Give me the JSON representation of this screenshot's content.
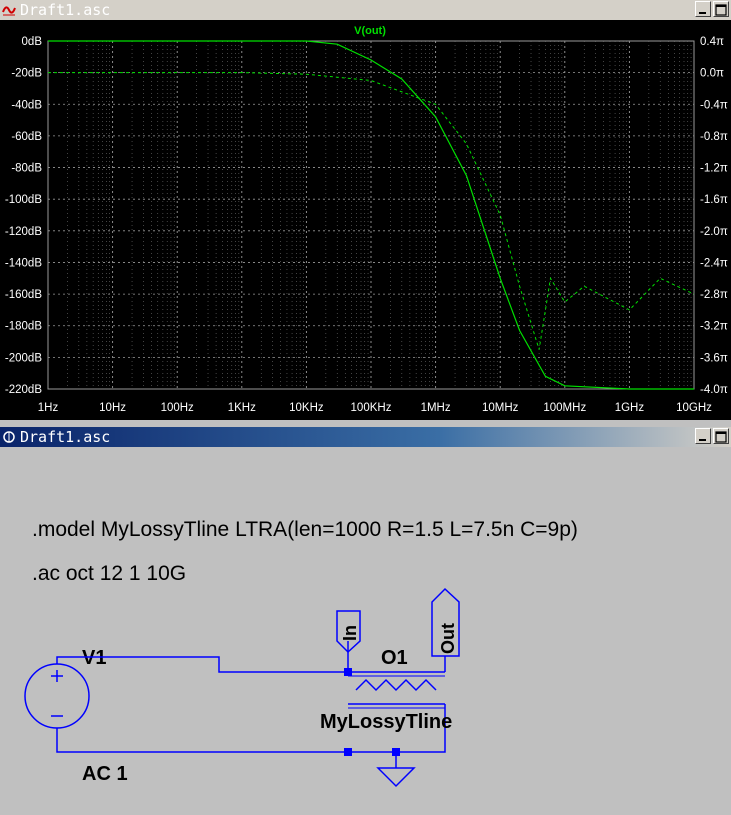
{
  "window_plot": {
    "title": "Draft1.asc"
  },
  "window_schematic": {
    "title": "Draft1.asc"
  },
  "plot": {
    "trace_label": "V(out)",
    "left_axis_ticks": [
      "0dB",
      "-20dB",
      "-40dB",
      "-60dB",
      "-80dB",
      "-100dB",
      "-120dB",
      "-140dB",
      "-160dB",
      "-180dB",
      "-200dB",
      "-220dB"
    ],
    "right_axis_ticks": [
      "0.4π",
      "0.0π",
      "-0.4π",
      "-0.8π",
      "-1.2π",
      "-1.6π",
      "-2.0π",
      "-2.4π",
      "-2.8π",
      "-3.2π",
      "-3.6π",
      "-4.0π"
    ],
    "x_axis_ticks": [
      "1Hz",
      "10Hz",
      "100Hz",
      "1KHz",
      "10KHz",
      "100KHz",
      "1MHz",
      "10MHz",
      "100MHz",
      "1GHz",
      "10GHz"
    ],
    "colors": {
      "trace": "#00e000",
      "grid": "#9a9a9a",
      "labels": "#ffffff"
    }
  },
  "chart_data": {
    "type": "line",
    "title": "V(out)",
    "x_scale": "log",
    "xlim": [
      "1Hz",
      "10GHz"
    ],
    "ylim_left_dB": [
      -220,
      0
    ],
    "ylim_right_phase_pi": [
      -4.0,
      0.4
    ],
    "series": [
      {
        "name": "V(out)",
        "unit": "dB",
        "x": [
          1,
          10,
          100,
          1000,
          10000,
          30000,
          100000,
          300000,
          1000000,
          3000000,
          10000000,
          20000000,
          50000000,
          100000000,
          1000000000,
          10000000000
        ],
        "values": [
          0,
          0,
          0,
          0,
          0,
          -2,
          -12,
          -24,
          -48,
          -85,
          -150,
          -183,
          -212,
          -218,
          -220,
          -220
        ]
      },
      {
        "unit": "phase (π)",
        "x": [
          1,
          10,
          100,
          1000,
          10000,
          100000,
          1000000,
          3000000,
          10000000,
          20000000,
          40000000,
          60000000,
          100000000,
          200000000,
          1000000000,
          3000000000,
          10000000000
        ],
        "values": [
          0.0,
          0.0,
          0.0,
          0.0,
          -0.02,
          -0.1,
          -0.4,
          -0.9,
          -1.8,
          -2.7,
          -3.5,
          -2.6,
          -2.9,
          -2.7,
          -3.0,
          -2.6,
          -2.8
        ]
      }
    ]
  },
  "schematic": {
    "directive_model": ".model MyLossyTline LTRA(len=1000 R=1.5 L=7.5n C=9p)",
    "directive_ac": ".ac oct 12 1 10G",
    "source_name": "V1",
    "source_value": "AC 1",
    "label_in": "In",
    "label_out": "Out",
    "tline_name": "O1",
    "tline_model": "MyLossyTline",
    "colors": {
      "wire": "#0000ff",
      "text": "#000000",
      "node": "#0000ff"
    }
  }
}
